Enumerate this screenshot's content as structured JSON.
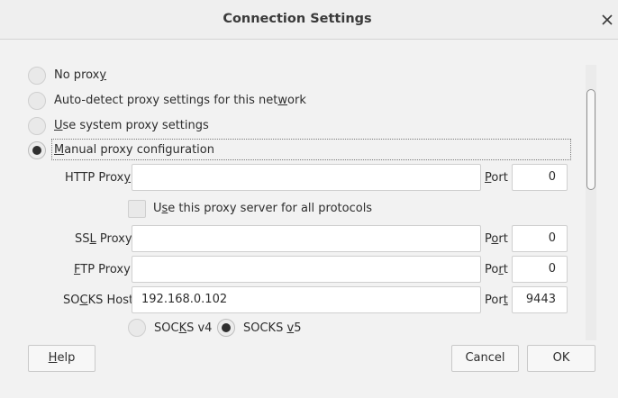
{
  "window": {
    "title": "Connection Settings",
    "close_icon": "close-icon"
  },
  "proxy_options": {
    "no_proxy": {
      "pre": "No prox",
      "key": "y",
      "post": ""
    },
    "auto_detect": {
      "pre": "Auto-detect proxy settings for this net",
      "key": "w",
      "post": "ork"
    },
    "system": {
      "pre": "",
      "key": "U",
      "post": "se system proxy settings"
    },
    "manual": {
      "pre": "",
      "key": "M",
      "post": "anual proxy configuration"
    },
    "selected": "manual"
  },
  "http": {
    "label_pre": "HTTP Prox",
    "label_key": "y",
    "label_post": "",
    "value": "",
    "port_key": "P",
    "port_post": "ort",
    "port": "0"
  },
  "use_for_all": {
    "pre": "U",
    "key": "s",
    "post": "e this proxy server for all protocols",
    "checked": false
  },
  "ssl": {
    "label_pre": "SS",
    "label_key": "L",
    "label_post": " Proxy",
    "value": "",
    "port_pre": "P",
    "port_key": "o",
    "port_post": "rt",
    "port": "0"
  },
  "ftp": {
    "label_pre": "",
    "label_key": "F",
    "label_post": "TP Proxy",
    "value": "",
    "port_pre": "Po",
    "port_key": "r",
    "port_post": "t",
    "port": "0"
  },
  "socks": {
    "label_pre": "SO",
    "label_key": "C",
    "label_post": "KS Host",
    "value": "192.168.0.102",
    "port_pre": "Por",
    "port_key": "t",
    "port_post": "",
    "port": "9443",
    "v4": {
      "pre": "SOC",
      "key": "K",
      "post": "S v4"
    },
    "v5": {
      "pre": "SOCKS ",
      "key": "v",
      "post": "5"
    },
    "selected": "v5"
  },
  "buttons": {
    "help": {
      "pre": "",
      "key": "H",
      "post": "elp"
    },
    "cancel": "Cancel",
    "ok": "OK"
  }
}
